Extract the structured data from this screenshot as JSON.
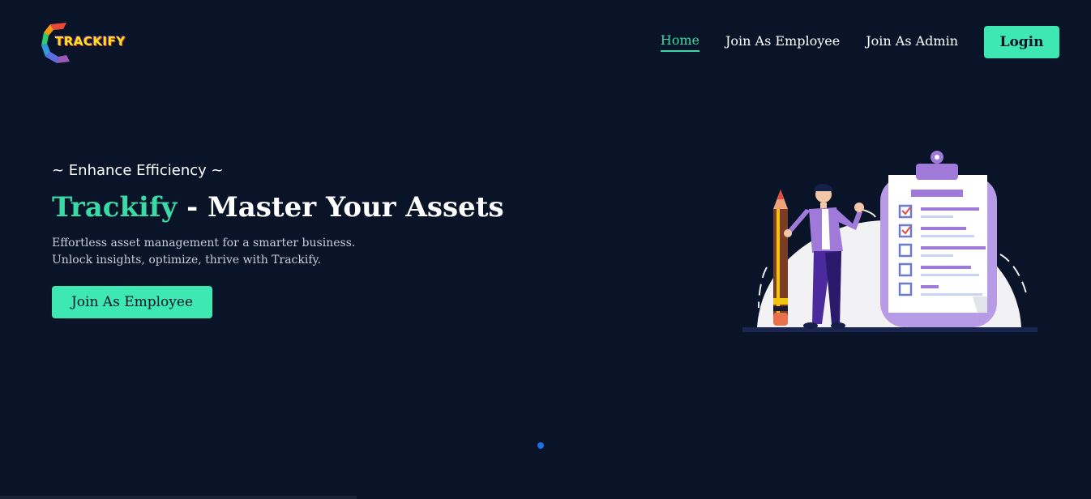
{
  "brand": {
    "logo_text": "TRACKIFY"
  },
  "nav": {
    "links": [
      {
        "label": "Home",
        "active": true
      },
      {
        "label": "Join As Employee",
        "active": false
      },
      {
        "label": "Join As Admin",
        "active": false
      }
    ],
    "login_label": "Login"
  },
  "hero": {
    "tagline": "~ Enhance Efficiency ~",
    "headline_brand": "Trackify",
    "headline_rest": " - Master Your Assets",
    "description": "Effortless asset management for a smarter business. Unlock insights, optimize, thrive with Trackify.",
    "cta_label": "Join As Employee"
  },
  "carousel": {
    "active_slide": 1,
    "total_slides": 1
  },
  "colors": {
    "background": "#0a1428",
    "accent": "#3de8b3",
    "accent_text": "#3bd9a5",
    "dot": "#1e6fe8",
    "illustration_purple": "#a07ad8"
  },
  "icons": [
    "trackify-logo-icon",
    "clipboard-checklist-illustration"
  ]
}
